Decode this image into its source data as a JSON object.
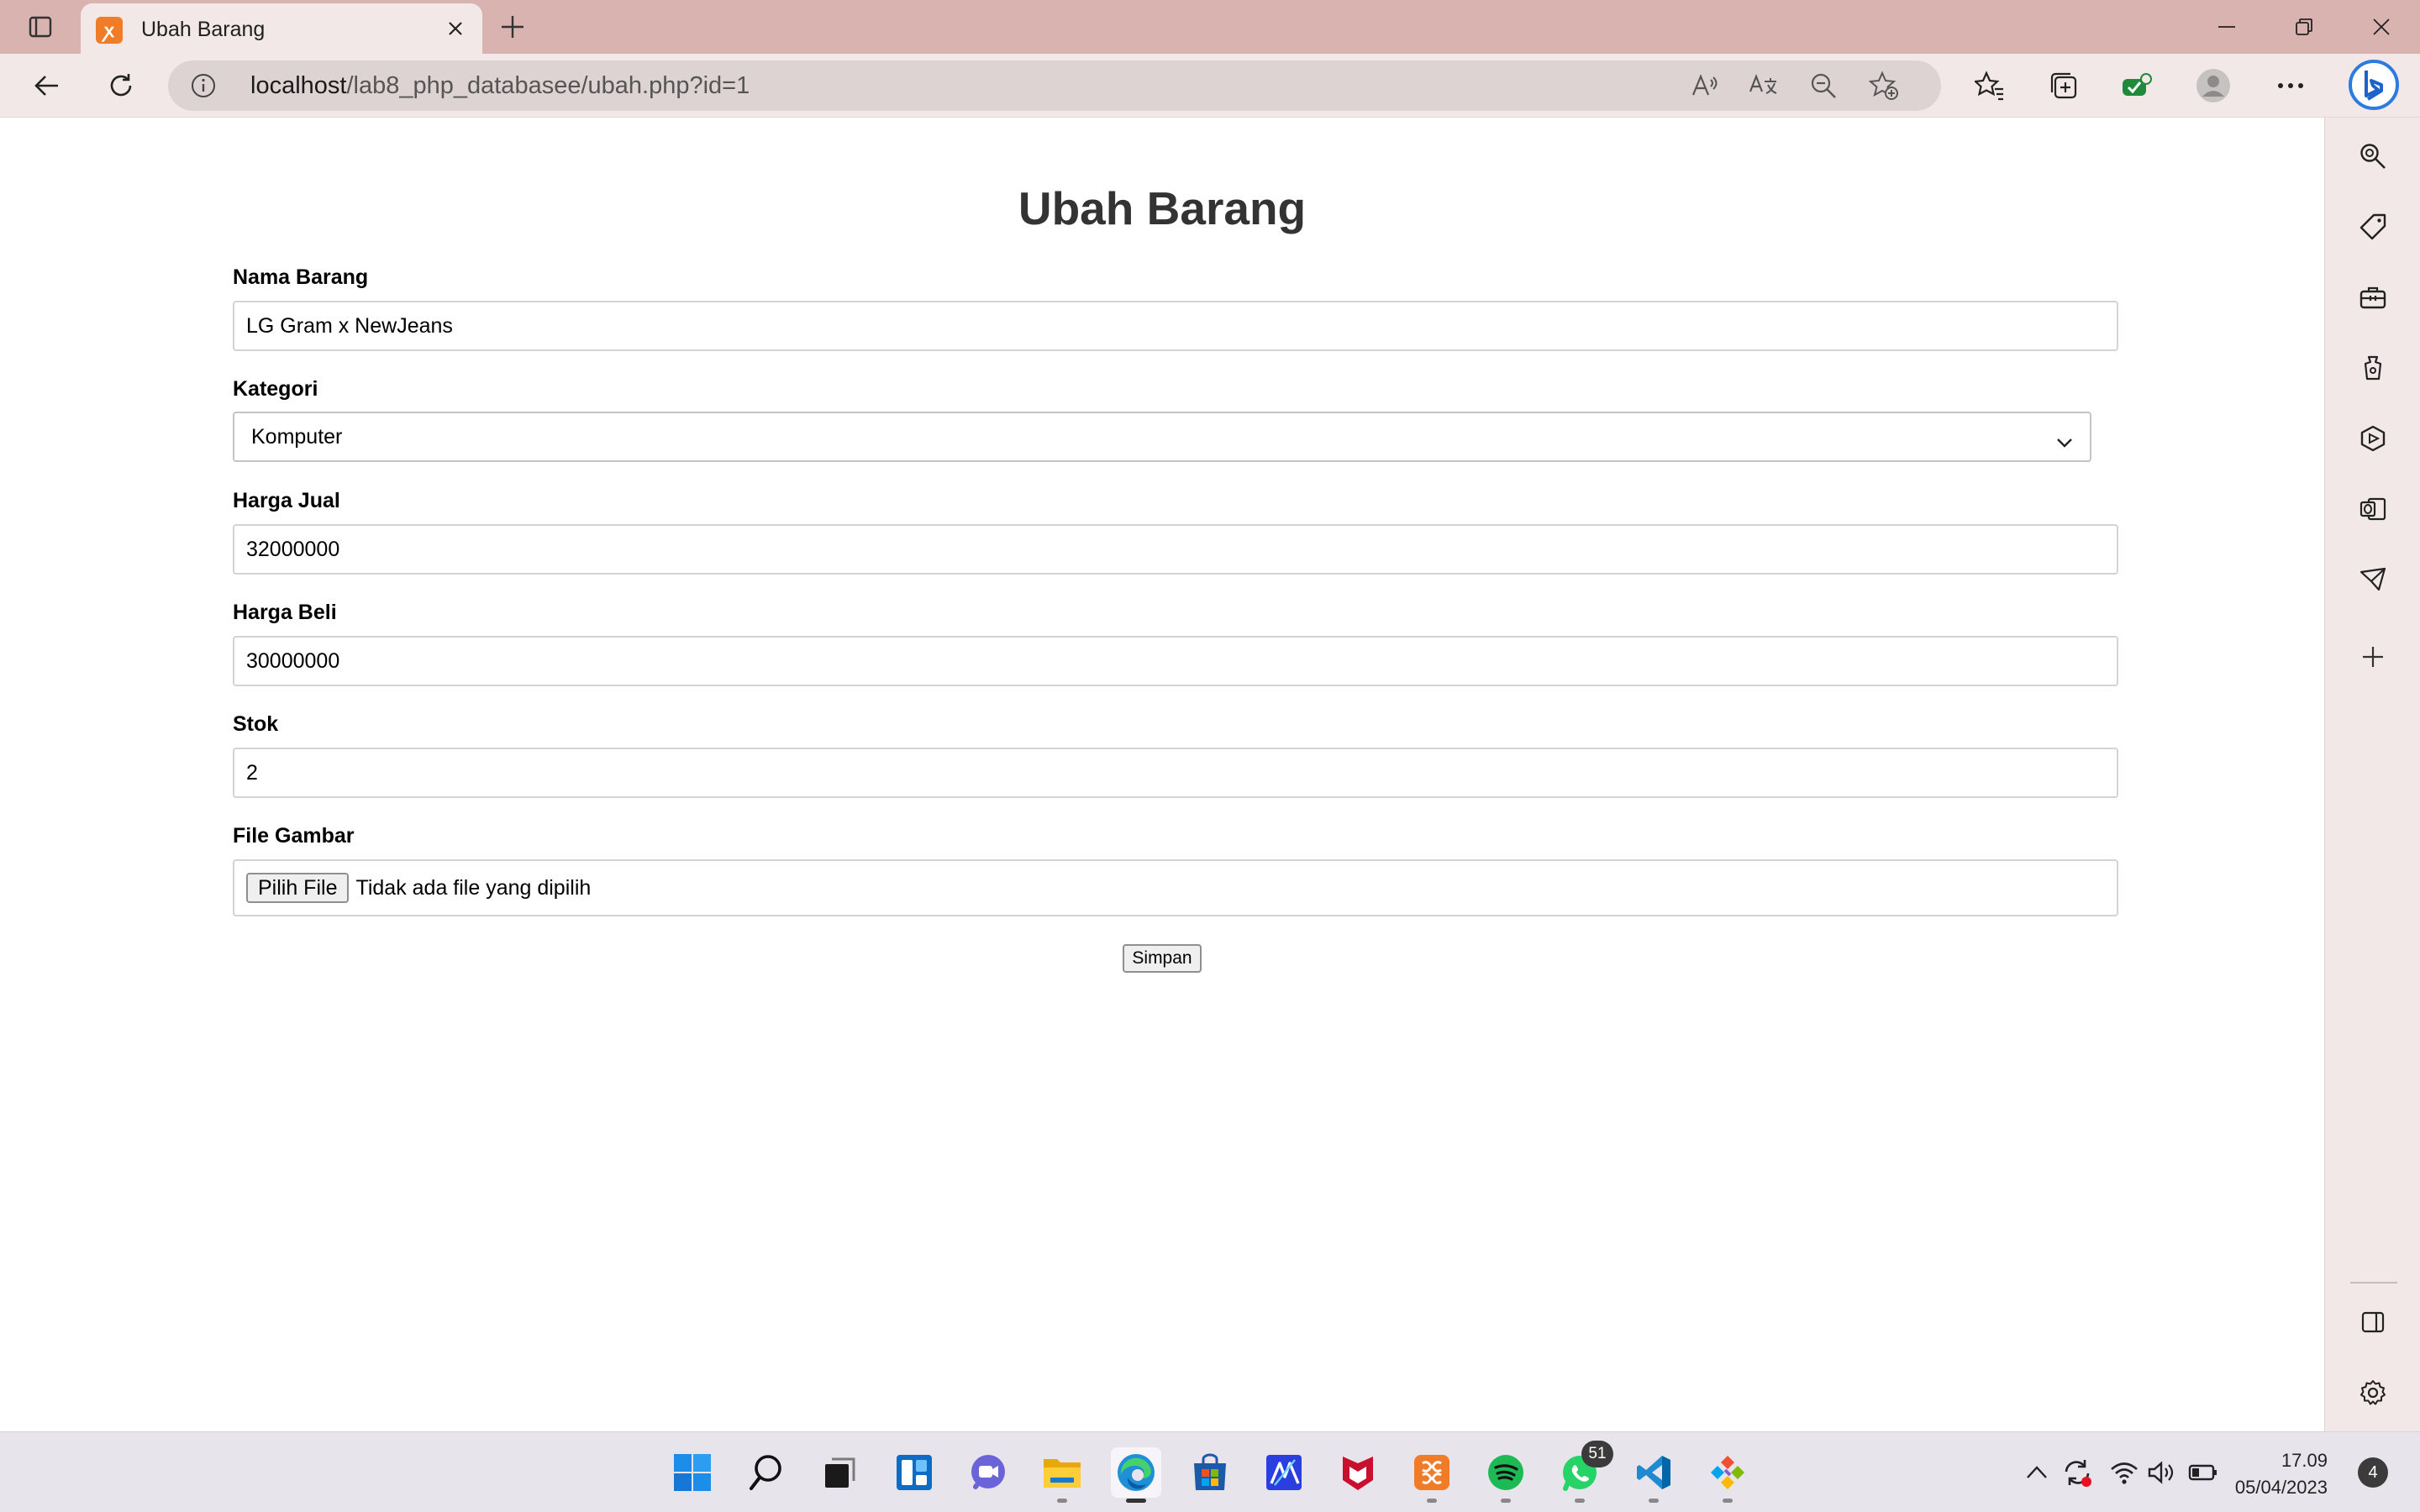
{
  "browser": {
    "tab_title": "Ubah Barang",
    "url_host": "localhost",
    "url_path": "/lab8_php_databasee/ubah.php?id=1"
  },
  "form": {
    "title": "Ubah Barang",
    "nama_label": "Nama Barang",
    "nama_value": "LG Gram x NewJeans",
    "kategori_label": "Kategori",
    "kategori_value": "Komputer",
    "harga_jual_label": "Harga Jual",
    "harga_jual_value": "32000000",
    "harga_beli_label": "Harga Beli",
    "harga_beli_value": "30000000",
    "stok_label": "Stok",
    "stok_value": "2",
    "file_label": "File Gambar",
    "file_button": "Pilih File",
    "file_status": "Tidak ada file yang dipilih",
    "submit_label": "Simpan"
  },
  "taskbar": {
    "whatsapp_badge": "51",
    "time": "17.09",
    "date": "05/04/2023",
    "notification_count": "4",
    "apps": [
      "start-icon",
      "search-icon",
      "task-view-icon",
      "widgets-icon",
      "teams-chat-icon",
      "file-explorer-icon",
      "edge-icon",
      "microsoft-store-icon",
      "app-icon",
      "mcafee-icon",
      "xampp-icon",
      "spotify-icon",
      "whatsapp-icon",
      "vscode-icon",
      "git-icon"
    ]
  },
  "colors": {
    "titlebar": "#d9b3b0",
    "toolbar": "#f3e8e8",
    "accent_xampp": "#f07c28"
  }
}
